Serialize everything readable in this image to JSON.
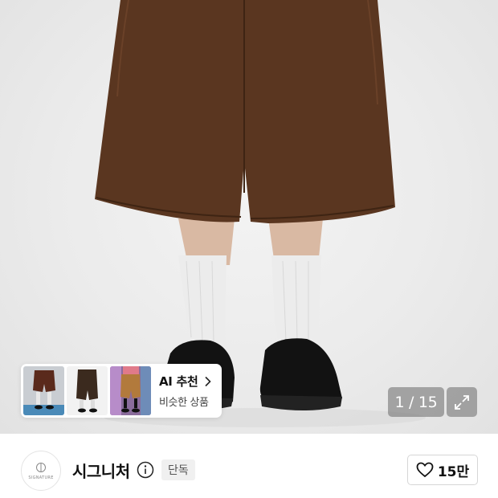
{
  "ai_card": {
    "title": "AI 추천",
    "subtitle": "비슷한 상품",
    "thumbnails": [
      "shorts-thumb-1",
      "shorts-thumb-2",
      "shorts-thumb-3"
    ]
  },
  "gallery": {
    "counter": "1 / 15"
  },
  "store": {
    "logo_text": "SIGNATURE",
    "name": "시그니처",
    "badge": "단독",
    "like_count": "15만"
  },
  "icons": {
    "chevron": "chevron-right-icon",
    "expand": "expand-icon",
    "info": "info-icon",
    "heart": "heart-icon"
  },
  "colors": {
    "product": "#5a3620",
    "accent_text": "#111111"
  }
}
